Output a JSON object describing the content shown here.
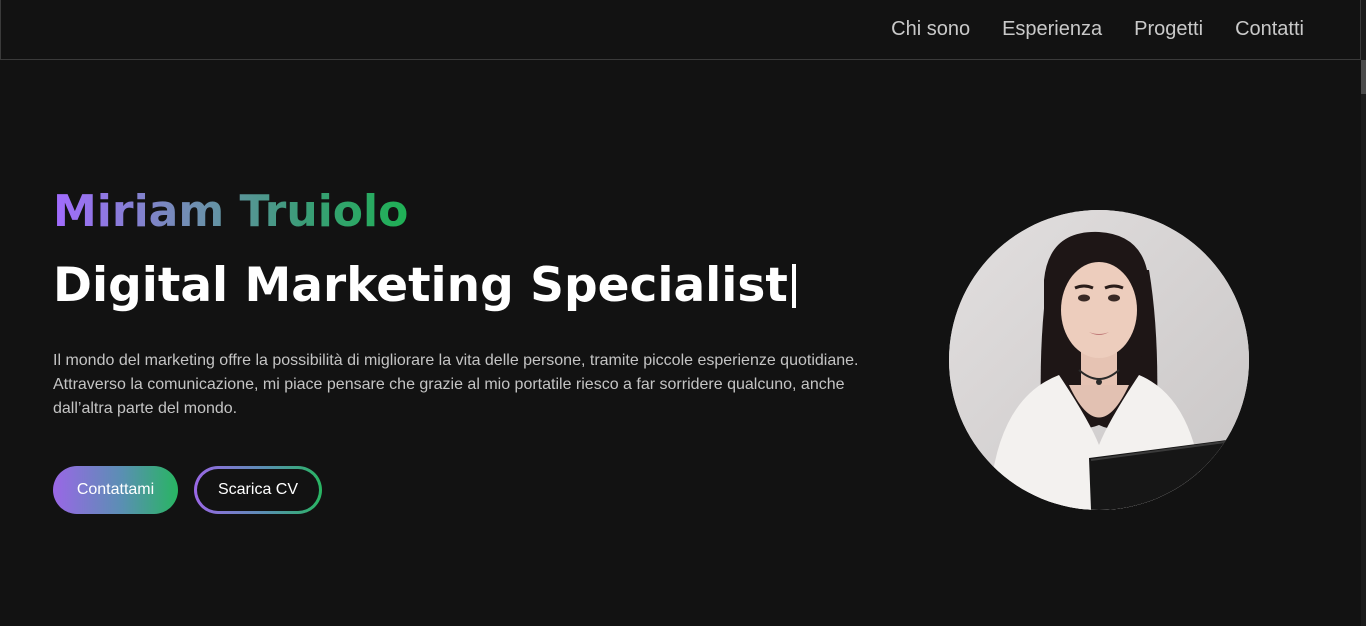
{
  "nav": {
    "items": [
      {
        "label": "Chi sono"
      },
      {
        "label": "Esperienza"
      },
      {
        "label": "Progetti"
      },
      {
        "label": "Contatti"
      }
    ]
  },
  "hero": {
    "name": "Miriam Truiolo",
    "role": "Digital Marketing Specialist",
    "description": "Il mondo del marketing offre la possibilità di migliorare la vita delle persone, tramite piccole esperienze quotidiane. Attraverso la comunicazione, mi piace pensare che grazie al mio portatile riesco a far sorridere qualcuno, anche dall’altra parte del mondo.",
    "primary_button": "Contattami",
    "secondary_button": "Scarica CV"
  },
  "colors": {
    "background": "#121212",
    "accent_purple": "#a26bff",
    "accent_green": "#1fb155",
    "nav_text": "#c9c9c9"
  }
}
